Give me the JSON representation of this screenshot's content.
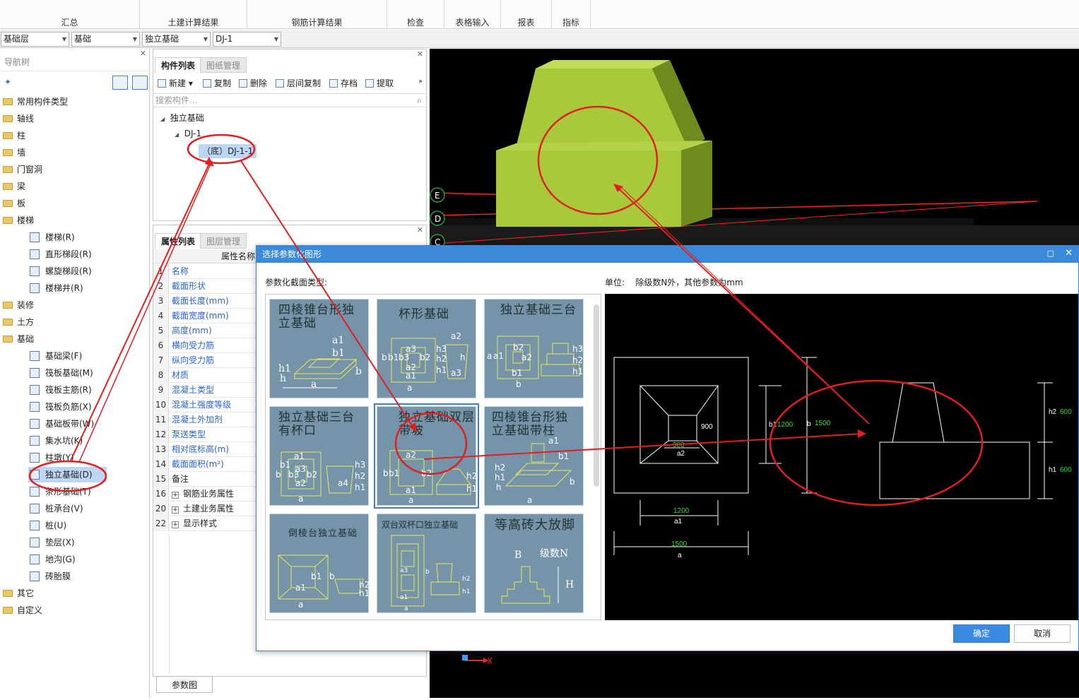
{
  "ribbon": {
    "groups": [
      "汇总",
      "土建计算结果",
      "钢筋计算结果",
      "检查",
      "表格输入",
      "报表",
      "指标"
    ]
  },
  "selectors": {
    "floor": "基础层",
    "category": "基础",
    "type": "独立基础",
    "component": "DJ-1"
  },
  "nav": {
    "title": "导航树",
    "items": [
      {
        "label": "常用构件类型",
        "kind": "folder"
      },
      {
        "label": "轴线",
        "kind": "folder"
      },
      {
        "label": "柱",
        "kind": "folder"
      },
      {
        "label": "墙",
        "kind": "folder"
      },
      {
        "label": "门窗洞",
        "kind": "folder"
      },
      {
        "label": "梁",
        "kind": "folder"
      },
      {
        "label": "板",
        "kind": "folder"
      },
      {
        "label": "楼梯",
        "kind": "folder"
      },
      {
        "label": "楼梯(R)",
        "kind": "sub"
      },
      {
        "label": "直形梯段(R)",
        "kind": "sub"
      },
      {
        "label": "螺旋梯段(R)",
        "kind": "sub"
      },
      {
        "label": "楼梯井(R)",
        "kind": "sub"
      },
      {
        "label": "装修",
        "kind": "folder"
      },
      {
        "label": "土方",
        "kind": "folder"
      },
      {
        "label": "基础",
        "kind": "folder"
      },
      {
        "label": "基础梁(F)",
        "kind": "sub"
      },
      {
        "label": "筏板基础(M)",
        "kind": "sub"
      },
      {
        "label": "筏板主筋(R)",
        "kind": "sub"
      },
      {
        "label": "筏板负筋(X)",
        "kind": "sub"
      },
      {
        "label": "基础板带(W)",
        "kind": "sub"
      },
      {
        "label": "集水坑(K)",
        "kind": "sub"
      },
      {
        "label": "柱墩(Y)",
        "kind": "sub"
      },
      {
        "label": "独立基础(D)",
        "kind": "sub",
        "selected": true
      },
      {
        "label": "条形基础(T)",
        "kind": "sub"
      },
      {
        "label": "桩承台(V)",
        "kind": "sub"
      },
      {
        "label": "桩(U)",
        "kind": "sub"
      },
      {
        "label": "垫层(X)",
        "kind": "sub"
      },
      {
        "label": "地沟(G)",
        "kind": "sub"
      },
      {
        "label": "砖胎膜",
        "kind": "sub"
      },
      {
        "label": "其它",
        "kind": "folder"
      },
      {
        "label": "自定义",
        "kind": "folder"
      }
    ]
  },
  "components": {
    "tabs": [
      "构件列表",
      "图纸管理"
    ],
    "toolbar": [
      "新建",
      "复制",
      "删除",
      "层间复制",
      "存档",
      "提取"
    ],
    "search_placeholder": "搜索构件...",
    "tree": {
      "root": "独立基础",
      "child": "DJ-1",
      "leaf": "（底）DJ-1-1"
    }
  },
  "properties": {
    "tabs": [
      "属性列表",
      "图层管理"
    ],
    "column_header": "属性名称",
    "rows": [
      {
        "no": "1",
        "name": "名称"
      },
      {
        "no": "2",
        "name": "截面形状"
      },
      {
        "no": "3",
        "name": "截面长度(mm)"
      },
      {
        "no": "4",
        "name": "截面宽度(mm)"
      },
      {
        "no": "5",
        "name": "高度(mm)"
      },
      {
        "no": "6",
        "name": "横向受力筋"
      },
      {
        "no": "7",
        "name": "纵向受力筋"
      },
      {
        "no": "8",
        "name": "材质"
      },
      {
        "no": "9",
        "name": "混凝土类型"
      },
      {
        "no": "10",
        "name": "混凝土强度等级"
      },
      {
        "no": "11",
        "name": "混凝土外加剂"
      },
      {
        "no": "12",
        "name": "泵送类型"
      },
      {
        "no": "13",
        "name": "相对底标高(m)"
      },
      {
        "no": "14",
        "name": "截面面积(m²)"
      },
      {
        "no": "15",
        "name": "备注"
      },
      {
        "no": "16",
        "name": "钢筋业务属性"
      },
      {
        "no": "20",
        "name": "土建业务属性"
      },
      {
        "no": "22",
        "name": "显示样式"
      }
    ],
    "param_button": "参数图"
  },
  "viewport": {
    "axis_labels": [
      "E",
      "D",
      "C"
    ],
    "axis_x_label": "X",
    "colors": {
      "block": "#a8c93a",
      "block_side": "#6f8a1e",
      "grid": "#ff2020"
    }
  },
  "dialog": {
    "title": "选择参数化图形",
    "section_label": "参数化截面类型:",
    "unit_label": "单位:",
    "unit_text": "除级数N外，其他参数为mm",
    "shapes": [
      {
        "title": "四棱锥台形独立基础"
      },
      {
        "title": "杯形基础"
      },
      {
        "title": "独立基础三台"
      },
      {
        "title": "独立基础三台有杯口"
      },
      {
        "title": "独立基础双层带坡",
        "selected": true
      },
      {
        "title": "四棱锥台形独立基础带柱"
      },
      {
        "title": "倒棱台独立基础"
      },
      {
        "title": "双台双杯口独立基础"
      },
      {
        "title": "等高砖大放脚"
      }
    ],
    "thumb_labels": {
      "t1": [
        "a1",
        "b1",
        "h1",
        "h",
        "a",
        "b"
      ],
      "t2": [
        "a2",
        "a3",
        "b",
        "b1",
        "b3",
        "b2",
        "a2",
        "a1",
        "a",
        "h3",
        "h2",
        "h1",
        "h",
        "a3"
      ],
      "t3": [
        "a",
        "a1",
        "b2",
        "a2",
        "b1",
        "b",
        "h3",
        "h2",
        "h1"
      ],
      "t4": [
        "a1",
        "a3",
        "a2",
        "b1",
        "b",
        "b3",
        "b2",
        "a4",
        "h3",
        "h2",
        "h1",
        "a"
      ],
      "t5": [
        "a2",
        "b1",
        "b",
        "b2",
        "a1",
        "a",
        "h2",
        "h1"
      ],
      "t6": [
        "a1",
        "b1",
        "h2",
        "h1",
        "h",
        "b",
        "a"
      ],
      "t7": [
        "b1",
        "a1",
        "b",
        "h2",
        "h1",
        "a"
      ],
      "t8": [
        "a3",
        "a1",
        "b",
        "h2",
        "h1",
        "a"
      ],
      "t9": [
        "B",
        "级数N",
        "H"
      ]
    },
    "preview": {
      "dims": {
        "b2": "900",
        "a2": "900",
        "a2_name": "a2",
        "b1": "1200",
        "b1_name": "b1",
        "b": "1500",
        "b_name": "b",
        "a1": "1200",
        "a1_name": "a1",
        "a": "1500",
        "a_name": "a",
        "h2": "600",
        "h2_name": "h2",
        "h1": "600",
        "h1_name": "h1"
      },
      "dim_color": "#33dd33"
    },
    "ok": "确定",
    "cancel": "取消"
  }
}
